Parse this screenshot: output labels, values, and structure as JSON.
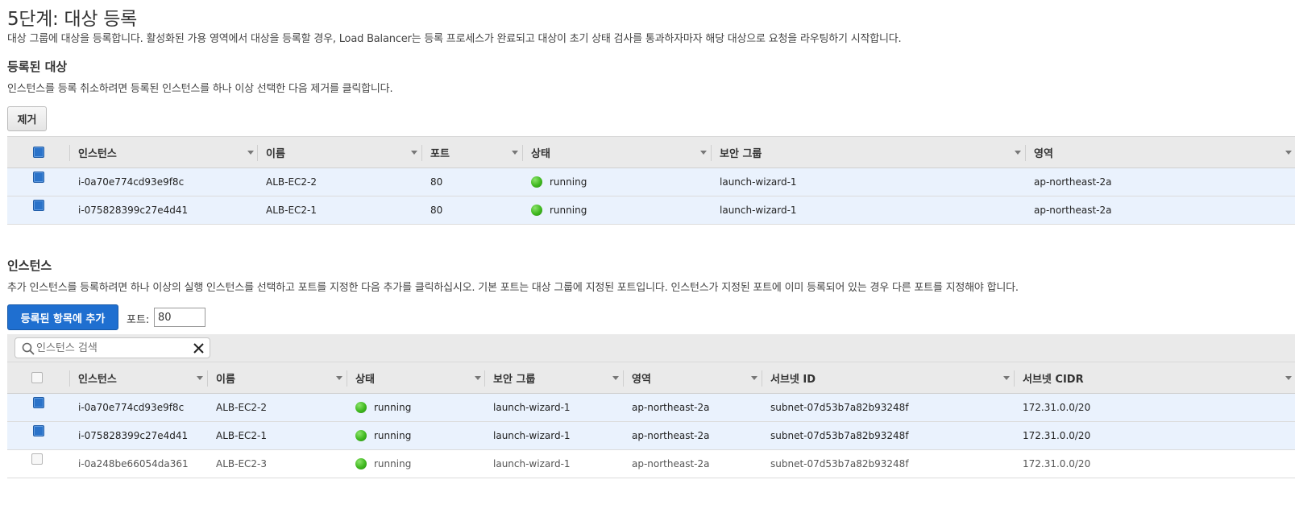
{
  "step": {
    "title": "5단계: 대상 등록",
    "description": "대상 그룹에 대상을 등록합니다. 활성화된 가용 영역에서 대상을 등록할 경우, Load Balancer는 등록 프로세스가 완료되고 대상이 초기 상태 검사를 통과하자마자 해당 대상으로 요청을 라우팅하기 시작합니다."
  },
  "registered": {
    "title": "등록된 대상",
    "description": "인스턴스를 등록 취소하려면 등록된 인스턴스를 하나 이상 선택한 다음 제거를 클릭합니다.",
    "remove_label": "제거",
    "columns": [
      "인스턴스",
      "이름",
      "포트",
      "상태",
      "보안 그룹",
      "영역"
    ],
    "header_checked": true,
    "rows": [
      {
        "checked": true,
        "instance": "i-0a70e774cd93e9f8c",
        "name": "ALB-EC2-2",
        "port": "80",
        "status": "running",
        "security_group": "launch-wizard-1",
        "zone": "ap-northeast-2a"
      },
      {
        "checked": true,
        "instance": "i-075828399c27e4d41",
        "name": "ALB-EC2-1",
        "port": "80",
        "status": "running",
        "security_group": "launch-wizard-1",
        "zone": "ap-northeast-2a"
      }
    ]
  },
  "instances": {
    "title": "인스턴스",
    "description": "추가 인스턴스를 등록하려면 하나 이상의 실행 인스턴스를 선택하고 포트를 지정한 다음 추가를 클릭하십시오. 기본 포트는 대상 그룹에 지정된 포트입니다. 인스턴스가 지정된 포트에 이미 등록되어 있는 경우 다른 포트를 지정해야 합니다.",
    "add_label": "등록된 항목에 추가",
    "port_label": "포트:",
    "port_value": "80",
    "search_placeholder": "인스턴스 검색",
    "columns": [
      "인스턴스",
      "이름",
      "상태",
      "보안 그룹",
      "영역",
      "서브넷 ID",
      "서브넷 CIDR"
    ],
    "header_checked": false,
    "rows": [
      {
        "checked": true,
        "instance": "i-0a70e774cd93e9f8c",
        "name": "ALB-EC2-2",
        "status": "running",
        "security_group": "launch-wizard-1",
        "zone": "ap-northeast-2a",
        "subnet_id": "subnet-07d53b7a82b93248f",
        "subnet_cidr": "172.31.0.0/20"
      },
      {
        "checked": true,
        "instance": "i-075828399c27e4d41",
        "name": "ALB-EC2-1",
        "status": "running",
        "security_group": "launch-wizard-1",
        "zone": "ap-northeast-2a",
        "subnet_id": "subnet-07d53b7a82b93248f",
        "subnet_cidr": "172.31.0.0/20"
      },
      {
        "checked": false,
        "instance": "i-0a248be66054da361",
        "name": "ALB-EC2-3",
        "status": "running",
        "security_group": "launch-wizard-1",
        "zone": "ap-northeast-2a",
        "subnet_id": "subnet-07d53b7a82b93248f",
        "subnet_cidr": "172.31.0.0/20"
      }
    ]
  },
  "colors": {
    "primary_button": "#1f6fd0",
    "selected_row": "#eaf2fd",
    "header_bg": "#eaeaea",
    "running": "#3fb81f"
  }
}
